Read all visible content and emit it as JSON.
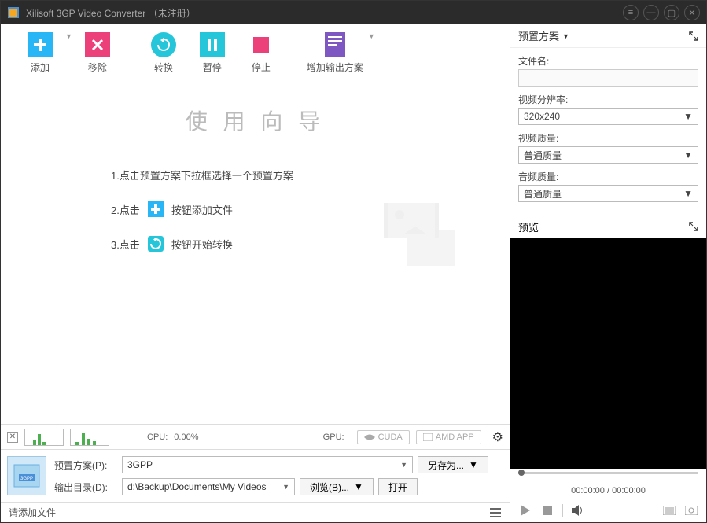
{
  "titlebar": {
    "title": "Xilisoft 3GP Video Converter （未注册）"
  },
  "toolbar": {
    "add": "添加",
    "remove": "移除",
    "convert": "转换",
    "pause": "暂停",
    "stop": "停止",
    "add_scheme": "增加输出方案"
  },
  "wizard": {
    "title": "使 用 向 导",
    "step1": "1.点击预置方案下拉框选择一个预置方案",
    "step2_a": "2.点击",
    "step2_b": "按钮添加文件",
    "step3_a": "3.点击",
    "step3_b": "按钮开始转换"
  },
  "status": {
    "cpu_label": "CPU:",
    "cpu_value": "0.00%",
    "gpu_label": "GPU:",
    "cuda": "CUDA",
    "amd": "AMD APP"
  },
  "output": {
    "preset_label": "预置方案(P):",
    "preset_value": "3GPP",
    "saveas": "另存为...",
    "dir_label": "输出目录(D):",
    "dir_value": "d:\\Backup\\Documents\\My Videos",
    "browse": "浏览(B)...",
    "open": "打开"
  },
  "bottombar": {
    "msg": "请添加文件"
  },
  "sidepanel": {
    "preset_head": "预置方案",
    "filename_label": "文件名:",
    "filename_value": "",
    "resolution_label": "视频分辨率:",
    "resolution_value": "320x240",
    "videoq_label": "视频质量:",
    "videoq_value": "普通质量",
    "audioq_label": "音频质量:",
    "audioq_value": "普通质量",
    "preview_head": "预览",
    "time": "00:00:00 / 00:00:00"
  }
}
